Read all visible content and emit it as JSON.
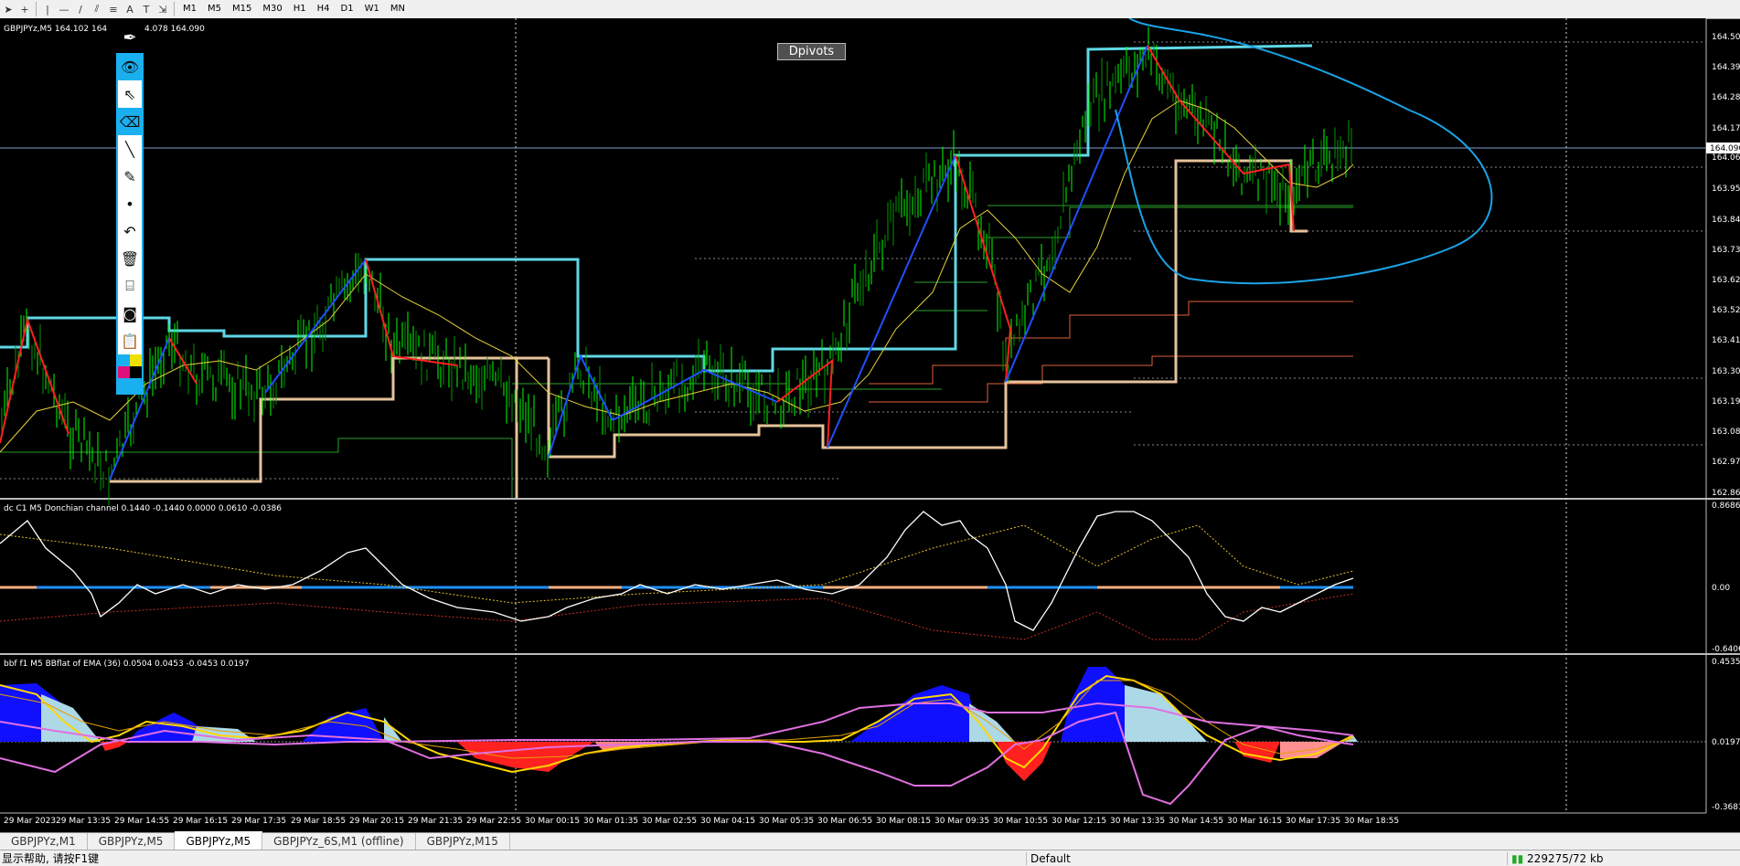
{
  "toolbar": {
    "timeframes": [
      "M1",
      "M5",
      "M15",
      "M30",
      "H1",
      "H4",
      "D1",
      "W1",
      "MN"
    ]
  },
  "main": {
    "symbol_info": "GBPJPYz,M5  164.102 164",
    "symbol_info2": "4.078 164.090",
    "dpivots_label": "Dpivots",
    "price_labels": [
      "164.500",
      "164.390",
      "164.285",
      "164.175",
      "164.063",
      "163.955",
      "163.845",
      "163.735",
      "163.625",
      "163.520",
      "163.410",
      "163.300",
      "163.190",
      "163.085",
      "162.975",
      "162.860"
    ],
    "current_price": "164.090"
  },
  "donchian": {
    "label": "dc C1 M5 Donchian channel 0.1440 -0.1440 0.0000 0.0610 -0.0386",
    "scale_top": "0.8686",
    "scale_mid": "0.00",
    "scale_bot": "-0.6406"
  },
  "bbflat": {
    "label": "bbf f1 M5 BBflat of EMA (36) 0.0504 0.0453 -0.0453 0.0197",
    "scale_top": "0.4535",
    "scale_mid": "0.0197",
    "scale_bot": "-0.3681"
  },
  "time_axis": [
    "29 Mar 2023",
    "29 Mar 13:35",
    "29 Mar 14:55",
    "29 Mar 16:15",
    "29 Mar 17:35",
    "29 Mar 18:55",
    "29 Mar 20:15",
    "29 Mar 21:35",
    "29 Mar 22:55",
    "30 Mar 00:15",
    "30 Mar 01:35",
    "30 Mar 02:55",
    "30 Mar 04:15",
    "30 Mar 05:35",
    "30 Mar 06:55",
    "30 Mar 08:15",
    "30 Mar 09:35",
    "30 Mar 10:55",
    "30 Mar 12:15",
    "30 Mar 13:35",
    "30 Mar 14:55",
    "30 Mar 16:15",
    "30 Mar 17:35",
    "30 Mar 18:55"
  ],
  "tabs": [
    "GBPJPYz,M1",
    "GBPJPYz,M5",
    "GBPJPYz,M5",
    "GBPJPYz_6S,M1 (offline)",
    "GBPJPYz,M15"
  ],
  "status": {
    "help": "显示帮助, 请按F1键",
    "profile": "Default",
    "traffic": "229275/72 kb"
  },
  "colors": {
    "candle": "#00ff00",
    "pivot": "#5fd7e6",
    "support": "#e6c39b",
    "zigzag_up": "#1e50ff",
    "zigzag_down": "#ff2020",
    "ellipse": "#1aa3e6"
  }
}
